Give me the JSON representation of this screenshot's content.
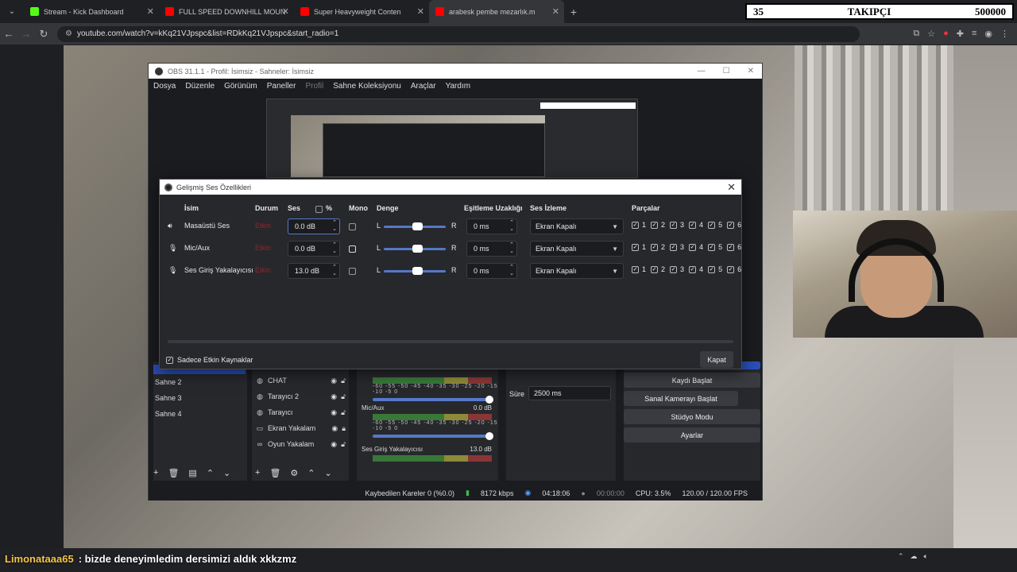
{
  "browser": {
    "tabs": [
      {
        "label": "Stream - Kick Dashboard",
        "icon": "kick-icon",
        "color": "#53fc18"
      },
      {
        "label": "FULL SPEED DOWNHILL MOUN",
        "icon": "youtube-icon",
        "color": "#ff0000"
      },
      {
        "label": "Super Heavyweight Conten",
        "icon": "youtube-icon",
        "color": "#ff0000"
      },
      {
        "label": "arabesk pembe mezarlık.m",
        "icon": "youtube-icon",
        "color": "#ff0000"
      }
    ],
    "url": "youtube.com/watch?v=kKq21VJpspc&list=RDkKq21VJpspc&start_radio=1"
  },
  "follow_overlay": {
    "left": "35",
    "middle": "TAKIPÇI",
    "right": "500000"
  },
  "obs": {
    "title": "OBS 31.1.1 - Profil: İsimsiz - Sahneler: İsimsiz",
    "menu": [
      "Dosya",
      "Düzenle",
      "Görünüm",
      "Paneller",
      "Profil",
      "Sahne Koleksiyonu",
      "Araçlar",
      "Yardım"
    ],
    "scenes": [
      "Sahne 2",
      "Sahne 3",
      "Sahne 4"
    ],
    "sources": [
      {
        "label": "CHAT",
        "icon": "browser-icon"
      },
      {
        "label": "Tarayıcı 2",
        "icon": "browser-icon"
      },
      {
        "label": "Tarayıcı",
        "icon": "browser-icon"
      },
      {
        "label": "Ekran Yakalam",
        "icon": "monitor-icon"
      },
      {
        "label": "Oyun Yakalam",
        "icon": "gamepad-icon"
      }
    ],
    "mixer": {
      "ticks": "-60 -55 -50 -45 -40 -35 -30 -25 -20 -15 -10 -5 0",
      "channels": [
        {
          "name": "Mic/Aux",
          "db": "0.0 dB"
        },
        {
          "name": "Ses Giriş Yakalayıcısı",
          "db": "13.0 dB"
        }
      ]
    },
    "transition": {
      "duration_label": "Süre",
      "duration_value": "2500 ms"
    },
    "controls": [
      "Kaydı Başlat",
      "Sanal Kamerayı Başlat",
      "Stüdyo Modu",
      "Ayarlar"
    ],
    "status": {
      "dropped": "Kaybedilen Kareler 0 (%0.0)",
      "bitrate": "8172 kbps",
      "stream_time": "04:18:06",
      "rec_time": "00:00:00",
      "cpu": "CPU: 3.5%",
      "fps": "120.00 / 120.00 FPS"
    }
  },
  "dialog": {
    "title": "Gelişmiş Ses Özellikleri",
    "headers": {
      "name": "İsim",
      "status": "Durum",
      "volume": "Ses",
      "percent": "%",
      "mono": "Mono",
      "balance": "Denge",
      "sync": "Eşitleme Uzaklığı",
      "monitoring": "Ses İzleme",
      "tracks": "Parçalar"
    },
    "rows": [
      {
        "name": "Masaüstü Ses",
        "icon": "speaker-icon",
        "status": "Etkin",
        "volume": "0.0 dB",
        "L": "L",
        "R": "R",
        "sync": "0 ms",
        "monitoring": "Ekran Kapalı"
      },
      {
        "name": "Mic/Aux",
        "icon": "microphone-icon",
        "status": "Etkin",
        "volume": "0.0 dB",
        "L": "L",
        "R": "R",
        "sync": "0 ms",
        "monitoring": "Ekran Kapalı"
      },
      {
        "name": "Ses Giriş Yakalayıcısı",
        "icon": "microphone-icon",
        "status": "Etkin",
        "volume": "13.0 dB",
        "L": "L",
        "R": "R",
        "sync": "0 ms",
        "monitoring": "Ekran Kapalı"
      }
    ],
    "track_numbers": [
      "1",
      "2",
      "3",
      "4",
      "5",
      "6"
    ],
    "active_only_label": "Sadece Etkin Kaynaklar",
    "close_label": "Kapat"
  },
  "chat": {
    "user": "Limonataaa65",
    "message": ": bizde deneyimledim dersimizi aldık xkkzmz"
  },
  "colors": {
    "status_inactive": "#8a2a2a",
    "accent": "#2b4fb8"
  }
}
